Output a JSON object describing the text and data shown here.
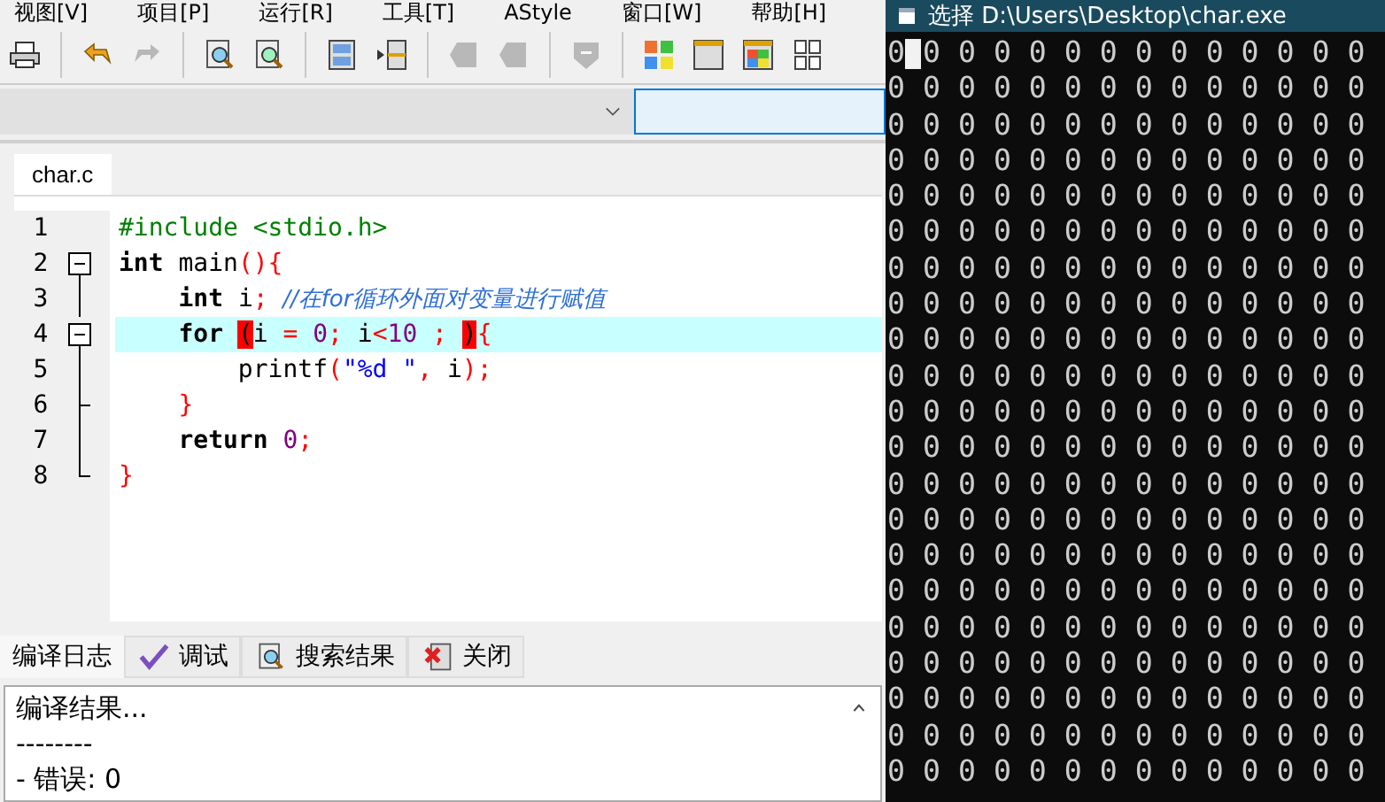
{
  "menu": [
    "视图[V]",
    "项目[P]",
    "运行[R]",
    "工具[T]",
    "AStyle",
    "窗口[W]",
    "帮助[H]"
  ],
  "toolbar": [
    {
      "kind": "printer",
      "disabled": false
    },
    {
      "kind": "sep"
    },
    {
      "kind": "undo",
      "disabled": false
    },
    {
      "kind": "redo",
      "disabled": true
    },
    {
      "kind": "sep"
    },
    {
      "kind": "find",
      "disabled": false
    },
    {
      "kind": "replace",
      "disabled": false
    },
    {
      "kind": "sep"
    },
    {
      "kind": "panels",
      "disabled": false
    },
    {
      "kind": "indent",
      "disabled": false
    },
    {
      "kind": "sep"
    },
    {
      "kind": "back",
      "disabled": true
    },
    {
      "kind": "forward",
      "disabled": true
    },
    {
      "kind": "sep"
    },
    {
      "kind": "shield",
      "disabled": true
    },
    {
      "kind": "sep"
    },
    {
      "kind": "grid",
      "disabled": false
    },
    {
      "kind": "window",
      "disabled": false
    },
    {
      "kind": "colors",
      "disabled": false
    },
    {
      "kind": "tiles",
      "disabled": false
    }
  ],
  "file_tabs": [
    {
      "label": "char.c",
      "selected": true
    }
  ],
  "code_lines": [
    {
      "number": "1",
      "kind": "plain",
      "highlighted": false,
      "tokens": [
        {
          "kind": "preproc",
          "text": "#include <stdio.h>"
        }
      ]
    },
    {
      "number": "2",
      "kind": "fold_start",
      "highlighted": false,
      "tokens": [
        {
          "kind": "keyword",
          "text": "int"
        },
        {
          "kind": "plain",
          "text": " main"
        },
        {
          "kind": "symbol",
          "text": "(){"
        }
      ]
    },
    {
      "number": "3",
      "kind": "fold_line",
      "highlighted": false,
      "tokens": [
        {
          "kind": "keyword",
          "text": "    int"
        },
        {
          "kind": "plain",
          "text": " i"
        },
        {
          "kind": "symbol",
          "text": ";"
        },
        {
          "kind": "comment",
          "text": "  //在for循环外面对变量进行赋值"
        }
      ]
    },
    {
      "number": "4",
      "kind": "fold_start",
      "highlighted": true,
      "tokens": [
        {
          "kind": "keyword",
          "text": "    for "
        },
        {
          "kind": "match",
          "text": "("
        },
        {
          "kind": "plain",
          "text": "i "
        },
        {
          "kind": "symbol",
          "text": "="
        },
        {
          "kind": "number",
          "text": " 0"
        },
        {
          "kind": "symbol",
          "text": ";"
        },
        {
          "kind": "plain",
          "text": " i"
        },
        {
          "kind": "symbol",
          "text": "<"
        },
        {
          "kind": "number",
          "text": "10"
        },
        {
          "kind": "symbol",
          "text": " ; "
        },
        {
          "kind": "match",
          "text": ")"
        },
        {
          "kind": "symbol",
          "text": "{"
        }
      ]
    },
    {
      "number": "5",
      "kind": "fold_line",
      "highlighted": false,
      "tokens": [
        {
          "kind": "plain",
          "text": "        printf"
        },
        {
          "kind": "symbol",
          "text": "("
        },
        {
          "kind": "string",
          "text": "\"%d \""
        },
        {
          "kind": "symbol",
          "text": ","
        },
        {
          "kind": "plain",
          "text": " i"
        },
        {
          "kind": "symbol",
          "text": ");"
        }
      ]
    },
    {
      "number": "6",
      "kind": "fold_branch",
      "highlighted": false,
      "tokens": [
        {
          "kind": "symbol",
          "text": "    }"
        }
      ]
    },
    {
      "number": "7",
      "kind": "fold_line",
      "highlighted": false,
      "tokens": [
        {
          "kind": "keyword",
          "text": "    return"
        },
        {
          "kind": "number",
          "text": " 0"
        },
        {
          "kind": "symbol",
          "text": ";"
        }
      ]
    },
    {
      "number": "8",
      "kind": "fold_end",
      "highlighted": false,
      "tokens": [
        {
          "kind": "symbol",
          "text": "}"
        }
      ]
    }
  ],
  "bottom_tabs": [
    {
      "label": "编译日志",
      "kind": "log",
      "selected": true
    },
    {
      "label": "调试",
      "kind": "debug",
      "selected": false
    },
    {
      "label": "搜索结果",
      "kind": "search",
      "selected": false
    },
    {
      "label": "关闭",
      "kind": "close",
      "selected": false
    }
  ],
  "compile_log": [
    "编译结果...",
    "--------",
    "- 错误: 0"
  ],
  "console": {
    "title": "选择 D:\\Users\\Desktop\\char.exe",
    "cursor_visible": true,
    "lines": [
      "0 0 0 0 0 0 0 0 0 0 0 0 0 0",
      "0 0 0 0 0 0 0 0 0 0 0 0 0 0",
      "0 0 0 0 0 0 0 0 0 0 0 0 0 0",
      "0 0 0 0 0 0 0 0 0 0 0 0 0 0",
      "0 0 0 0 0 0 0 0 0 0 0 0 0 0",
      "0 0 0 0 0 0 0 0 0 0 0 0 0 0",
      "0 0 0 0 0 0 0 0 0 0 0 0 0 0",
      "0 0 0 0 0 0 0 0 0 0 0 0 0 0",
      "0 0 0 0 0 0 0 0 0 0 0 0 0 0",
      "0 0 0 0 0 0 0 0 0 0 0 0 0 0",
      "0 0 0 0 0 0 0 0 0 0 0 0 0 0",
      "0 0 0 0 0 0 0 0 0 0 0 0 0 0",
      "0 0 0 0 0 0 0 0 0 0 0 0 0 0",
      "0 0 0 0 0 0 0 0 0 0 0 0 0 0",
      "0 0 0 0 0 0 0 0 0 0 0 0 0 0",
      "0 0 0 0 0 0 0 0 0 0 0 0 0 0",
      "0 0 0 0 0 0 0 0 0 0 0 0 0 0",
      "0 0 0 0 0 0 0 0 0 0 0 0 0 0",
      "0 0 0 0 0 0 0 0 0 0 0 0 0 0",
      "0 0 0 0 0 0 0 0 0 0 0 0 0 0",
      "0 0 0 0 0 0 0 0 0 0 0 0 0 0"
    ]
  }
}
